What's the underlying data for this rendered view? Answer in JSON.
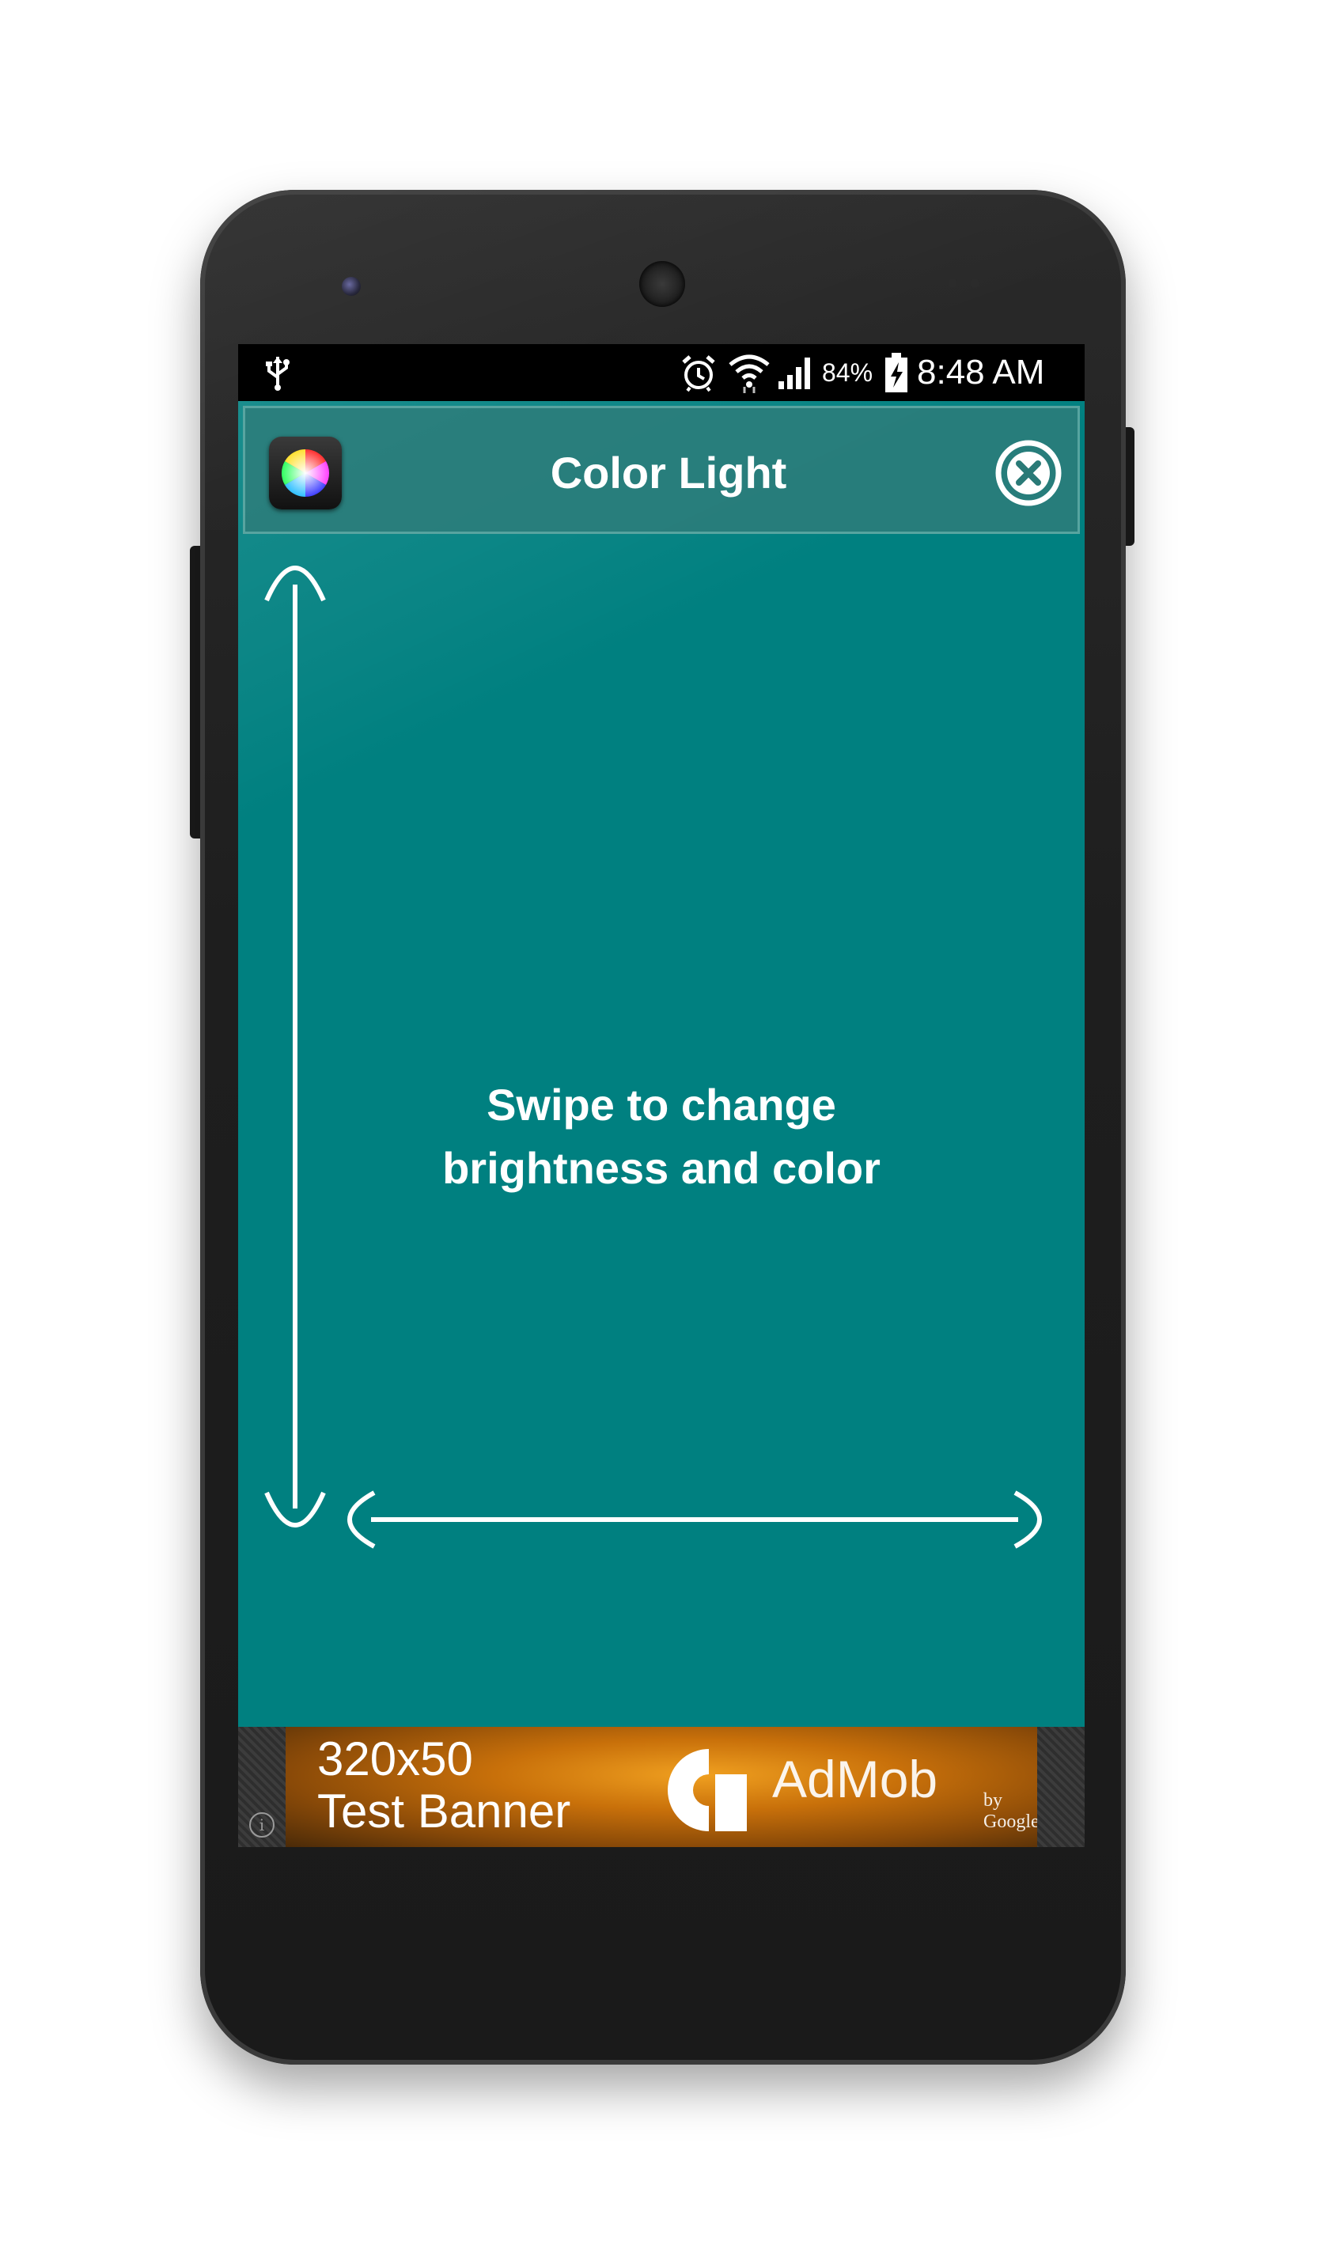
{
  "status_bar": {
    "battery_percent": "84%",
    "time": "8:48 AM",
    "icons": [
      "usb-icon",
      "alarm-icon",
      "wifi-icon",
      "signal-icon",
      "battery-charging-icon"
    ]
  },
  "app": {
    "title": "Color Light",
    "background_color": "#008080",
    "instructions_line1": "Swipe to change",
    "instructions_line2": "brightness and color"
  },
  "ad": {
    "size_label": "320x50",
    "test_label": "Test Banner",
    "brand": "AdMob",
    "by": "by Google"
  }
}
